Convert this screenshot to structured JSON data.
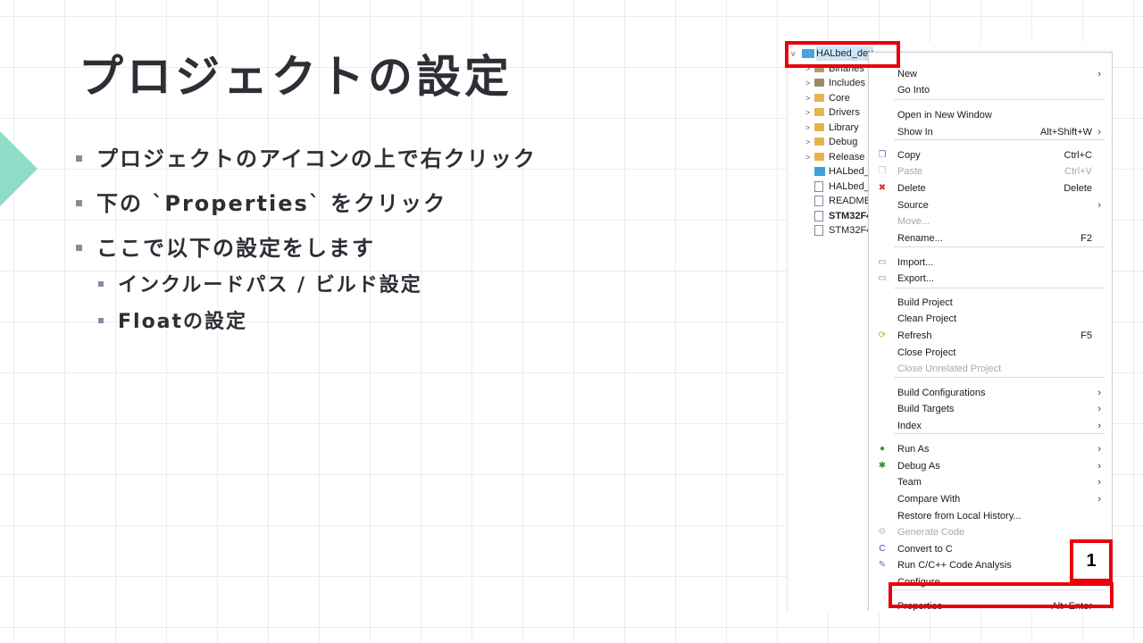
{
  "slide": {
    "title": "プロジェクトの設定",
    "bullets": [
      "プロジェクトのアイコンの上で右クリック",
      "下の `Properties` をクリック",
      "ここで以下の設定をします"
    ],
    "sub_bullets": [
      "インクルードパス / ビルド設定",
      "Floatの設定"
    ],
    "accent": "#8fdcc8",
    "highlight": "#e8000b"
  },
  "tree": {
    "project": "HALbed_dev",
    "items": [
      {
        "label": "Binaries",
        "kind": "special"
      },
      {
        "label": "Includes",
        "kind": "special"
      },
      {
        "label": "Core",
        "kind": "folder"
      },
      {
        "label": "Drivers",
        "kind": "folder"
      },
      {
        "label": "Library",
        "kind": "folder"
      },
      {
        "label": "Debug",
        "kind": "folder"
      },
      {
        "label": "Release",
        "kind": "folder"
      },
      {
        "label": "HALbed_",
        "kind": "mx-file"
      },
      {
        "label": "HALbed_",
        "kind": "file"
      },
      {
        "label": "README.",
        "kind": "file"
      },
      {
        "label": "STM32F4",
        "kind": "file"
      },
      {
        "label": "STM32F4",
        "kind": "file"
      }
    ]
  },
  "menu": {
    "items": [
      {
        "label": "New",
        "shortcut": "",
        "submenu": true,
        "icon": "",
        "disabled": false
      },
      {
        "label": "Go Into",
        "shortcut": "",
        "submenu": false,
        "icon": "",
        "disabled": false
      },
      {
        "label": "Open in New Window",
        "shortcut": "",
        "submenu": false,
        "icon": "",
        "disabled": false
      },
      {
        "label": "Show In",
        "shortcut": "Alt+Shift+W",
        "submenu": true,
        "icon": "",
        "disabled": false
      },
      {
        "label": "Copy",
        "shortcut": "Ctrl+C",
        "submenu": false,
        "icon": "copy-icon",
        "disabled": false
      },
      {
        "label": "Paste",
        "shortcut": "Ctrl+V",
        "submenu": false,
        "icon": "paste-icon",
        "disabled": true
      },
      {
        "label": "Delete",
        "shortcut": "Delete",
        "submenu": false,
        "icon": "delete-icon",
        "disabled": false
      },
      {
        "label": "Source",
        "shortcut": "",
        "submenu": true,
        "icon": "",
        "disabled": false
      },
      {
        "label": "Move...",
        "shortcut": "",
        "submenu": false,
        "icon": "",
        "disabled": true
      },
      {
        "label": "Rename...",
        "shortcut": "F2",
        "submenu": false,
        "icon": "",
        "disabled": false
      },
      {
        "label": "Import...",
        "shortcut": "",
        "submenu": false,
        "icon": "import-icon",
        "disabled": false
      },
      {
        "label": "Export...",
        "shortcut": "",
        "submenu": false,
        "icon": "export-icon",
        "disabled": false
      },
      {
        "label": "Build Project",
        "shortcut": "",
        "submenu": false,
        "icon": "",
        "disabled": false
      },
      {
        "label": "Clean Project",
        "shortcut": "",
        "submenu": false,
        "icon": "",
        "disabled": false
      },
      {
        "label": "Refresh",
        "shortcut": "F5",
        "submenu": false,
        "icon": "refresh-icon",
        "disabled": false
      },
      {
        "label": "Close Project",
        "shortcut": "",
        "submenu": false,
        "icon": "",
        "disabled": false
      },
      {
        "label": "Close Unrelated Project",
        "shortcut": "",
        "submenu": false,
        "icon": "",
        "disabled": true
      },
      {
        "label": "Build Configurations",
        "shortcut": "",
        "submenu": true,
        "icon": "",
        "disabled": false
      },
      {
        "label": "Build Targets",
        "shortcut": "",
        "submenu": true,
        "icon": "",
        "disabled": false
      },
      {
        "label": "Index",
        "shortcut": "",
        "submenu": true,
        "icon": "",
        "disabled": false
      },
      {
        "label": "Run As",
        "shortcut": "",
        "submenu": true,
        "icon": "run-icon",
        "disabled": false
      },
      {
        "label": "Debug As",
        "shortcut": "",
        "submenu": true,
        "icon": "debug-icon",
        "disabled": false
      },
      {
        "label": "Team",
        "shortcut": "",
        "submenu": true,
        "icon": "",
        "disabled": false
      },
      {
        "label": "Compare With",
        "shortcut": "",
        "submenu": true,
        "icon": "",
        "disabled": false
      },
      {
        "label": "Restore from Local History...",
        "shortcut": "",
        "submenu": false,
        "icon": "",
        "disabled": false
      },
      {
        "label": "Generate Code",
        "shortcut": "",
        "submenu": false,
        "icon": "generate-icon",
        "disabled": true
      },
      {
        "label": "Convert to C",
        "shortcut": "",
        "submenu": false,
        "icon": "convert-icon",
        "disabled": false
      },
      {
        "label": "Run C/C++ Code Analysis",
        "shortcut": "",
        "submenu": false,
        "icon": "analysis-icon",
        "disabled": false
      },
      {
        "label": "Configure",
        "shortcut": "",
        "submenu": true,
        "icon": "",
        "disabled": false
      },
      {
        "label": "Properties",
        "shortcut": "Alt+Enter",
        "submenu": false,
        "icon": "",
        "disabled": false
      }
    ]
  },
  "step_badge": "1"
}
